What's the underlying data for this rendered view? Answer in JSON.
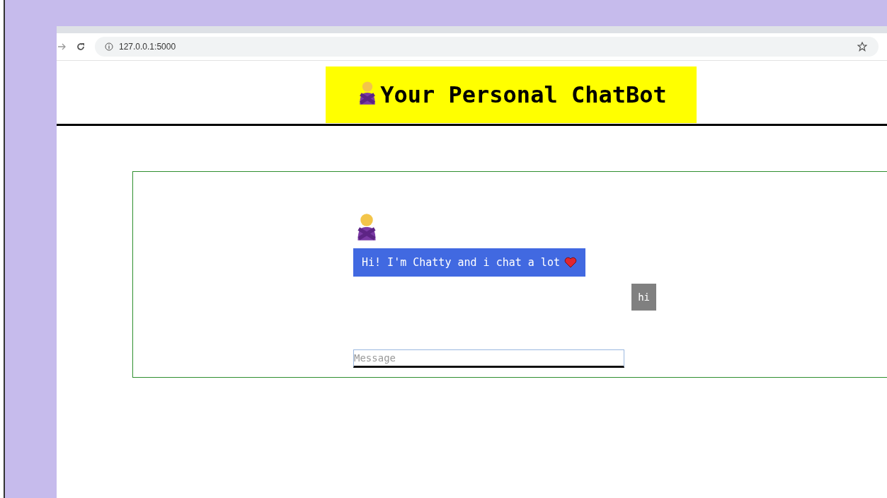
{
  "browser": {
    "url": "127.0.0.1:5000"
  },
  "header": {
    "title": "Your Personal ChatBot"
  },
  "chat": {
    "messages": [
      {
        "kind": "bot",
        "text": "Hi! I'm Chatty and i chat a lot"
      },
      {
        "kind": "user",
        "text": "hi"
      }
    ],
    "input": {
      "placeholder": "Message"
    }
  }
}
